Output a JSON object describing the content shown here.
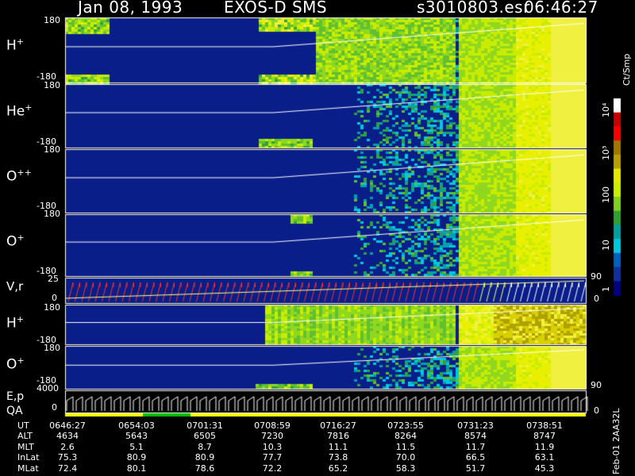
{
  "header": {
    "date": "Jan 08, 1993",
    "instrument": "EXOS-D SMS",
    "file": "s3010803.esr",
    "time": "06:46:27"
  },
  "panels": [
    {
      "id": "hplus",
      "label": "H",
      "sup": "+",
      "top_tick": "180",
      "bottom_tick": "-180"
    },
    {
      "id": "heplus",
      "label": "He",
      "sup": "+",
      "top_tick": "180",
      "bottom_tick": "-180"
    },
    {
      "id": "oplusplus",
      "label": "O",
      "sup": "++",
      "top_tick": "180",
      "bottom_tick": "-180"
    },
    {
      "id": "oplus",
      "label": "O",
      "sup": "+",
      "top_tick": "180",
      "bottom_tick": "-180"
    },
    {
      "id": "vr",
      "label": "V,r",
      "sup": "",
      "top_tick": "25",
      "bottom_tick": "0",
      "right_top": "90",
      "right_bottom": "0"
    },
    {
      "id": "hplus2",
      "label": "H",
      "sup": "+",
      "top_tick": "180",
      "bottom_tick": "-180"
    },
    {
      "id": "oplus2",
      "label": "O",
      "sup": "+",
      "top_tick": "180",
      "bottom_tick": "-180",
      "right_bottom": "90"
    },
    {
      "id": "ep",
      "label": "E,p",
      "sup": "",
      "top_tick": "4000",
      "bottom_tick": "0",
      "right_bottom": "0"
    }
  ],
  "qa_label": "QA",
  "colorbar": {
    "unit": "Ct/Smp",
    "ticks": [
      "10⁴",
      "10³",
      "100",
      "10",
      "1"
    ],
    "colors": [
      "#ffffff",
      "#c80000",
      "#ff0000",
      "#a07800",
      "#b8a000",
      "#e8e800",
      "#c8f000",
      "#80d020",
      "#30a030",
      "#00a0a0",
      "#00c8e0",
      "#0060c0",
      "#1030a0",
      "#000080"
    ]
  },
  "footer_id": "Feb-01 2AA32L",
  "chart_data": {
    "type": "heatmap",
    "title": "Jan 08, 1993   EXOS-D SMS",
    "time_labels": [
      "06:46:27",
      "0654:03",
      "0701:31",
      "0708:59",
      "0716:27",
      "0723:55",
      "0731:23",
      "0738:51"
    ],
    "rows": [
      {
        "name": "UT",
        "values": [
          "0646:27",
          "0654:03",
          "0701:31",
          "0708:59",
          "0716:27",
          "0723:55",
          "0731:23",
          "0738:51"
        ]
      },
      {
        "name": "ALT",
        "values": [
          "4634",
          "5643",
          "6505",
          "7230",
          "7816",
          "8264",
          "8574",
          "8747"
        ]
      },
      {
        "name": "MLT",
        "values": [
          "2.6",
          "5.1",
          "8.7",
          "10.3",
          "11.1",
          "11.5",
          "11.7",
          "11.9"
        ]
      },
      {
        "name": "InLat",
        "values": [
          "75.3",
          "80.9",
          "80.9",
          "77.7",
          "73.8",
          "70.0",
          "66.5",
          "63.1"
        ]
      },
      {
        "name": "MLat",
        "values": [
          "72.4",
          "80.1",
          "78.6",
          "72.2",
          "65.2",
          "58.3",
          "51.7",
          "45.3"
        ]
      }
    ],
    "color_scale_ticks": [
      "1",
      "10",
      "100",
      "10³",
      "10⁴"
    ]
  }
}
